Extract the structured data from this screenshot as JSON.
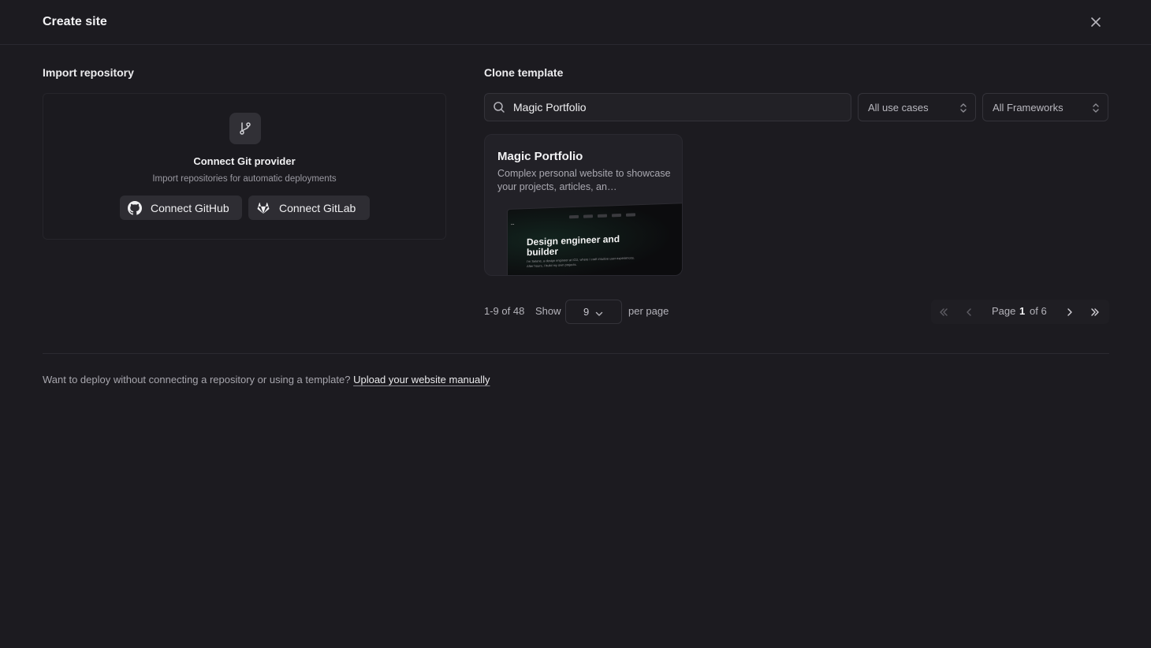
{
  "header": {
    "title": "Create site"
  },
  "import": {
    "section_title": "Import repository",
    "title": "Connect Git provider",
    "subtitle": "Import repositories for automatic deployments",
    "github_label": "Connect GitHub",
    "gitlab_label": "Connect GitLab"
  },
  "clone": {
    "section_title": "Clone template",
    "search_value": "Magic Portfolio",
    "use_case_select": "All use cases",
    "framework_select": "All Frameworks",
    "cards": [
      {
        "title": "Magic Portfolio",
        "description": "Complex personal website to showcase your projects, articles, an…",
        "preview_heading": "Design engineer and builder",
        "preview_text": "I'm Selene, a design engineer at ICD, where I craft intuitive user experiences. After hours, I build my own projects."
      }
    ]
  },
  "pagination": {
    "range": "1-9 of 48",
    "show_label": "Show",
    "per_page_value": "9",
    "per_page_label": "per page",
    "page_label": "Page",
    "current_page": "1",
    "of_label": "of 6"
  },
  "footer": {
    "text": "Want to deploy without connecting a repository or using a template?",
    "link": "Upload your website manually"
  },
  "colors": {
    "background": "#1c1b20",
    "panel": "#222127",
    "border": "#34333a",
    "text_primary": "#f2f2f4",
    "text_secondary": "#a7a6ad"
  }
}
